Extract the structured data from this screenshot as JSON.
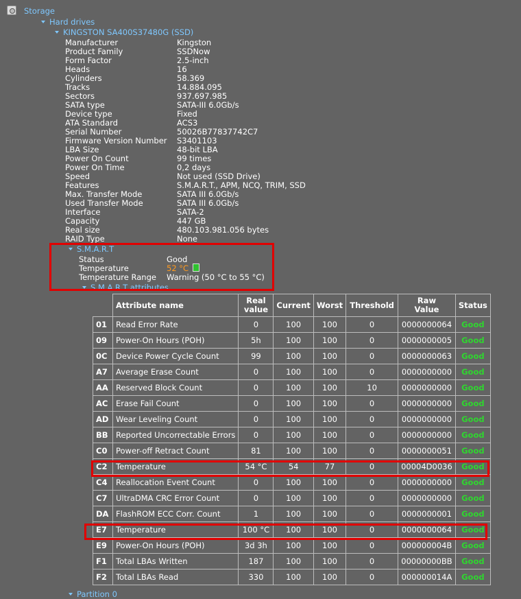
{
  "tree": {
    "root": "Storage",
    "hard_drives": "Hard drives",
    "drive": "KINGSTON SA400S37480G (SSD)",
    "smart": "S.M.A.R.T",
    "smart_attributes": "S.M.A.R.T attributes",
    "partition": "Partition 0"
  },
  "properties": [
    {
      "label": "Manufacturer",
      "value": "Kingston"
    },
    {
      "label": "Product Family",
      "value": "SSDNow"
    },
    {
      "label": "Form Factor",
      "value": "2.5-inch"
    },
    {
      "label": "Heads",
      "value": "16"
    },
    {
      "label": "Cylinders",
      "value": "58.369"
    },
    {
      "label": "Tracks",
      "value": "14.884.095"
    },
    {
      "label": "Sectors",
      "value": "937.697.985"
    },
    {
      "label": "SATA type",
      "value": "SATA-III 6.0Gb/s"
    },
    {
      "label": "Device type",
      "value": "Fixed"
    },
    {
      "label": "ATA Standard",
      "value": "ACS3"
    },
    {
      "label": "Serial Number",
      "value": "50026B77837742C7"
    },
    {
      "label": "Firmware Version Number",
      "value": "S3401103"
    },
    {
      "label": "LBA Size",
      "value": "48-bit LBA"
    },
    {
      "label": "Power On Count",
      "value": "99 times"
    },
    {
      "label": "Power On Time",
      "value": "0,2 days"
    },
    {
      "label": "Speed",
      "value": "Not used (SSD Drive)"
    },
    {
      "label": "Features",
      "value": "S.M.A.R.T., APM, NCQ, TRIM, SSD"
    },
    {
      "label": "Max. Transfer Mode",
      "value": "SATA III 6.0Gb/s"
    },
    {
      "label": "Used Transfer Mode",
      "value": "SATA III 6.0Gb/s"
    },
    {
      "label": "Interface",
      "value": "SATA-2"
    },
    {
      "label": "Capacity",
      "value": "447 GB"
    },
    {
      "label": "Real size",
      "value": "480.103.981.056 bytes"
    },
    {
      "label": "RAID Type",
      "value": "None"
    }
  ],
  "smart": {
    "status_label": "Status",
    "status_value": "Good",
    "temperature_label": "Temperature",
    "temperature_value": "52 °C",
    "temperature_range_label": "Temperature Range",
    "temperature_range_value": "Warning (50 °C to 55 °C)"
  },
  "colors": {
    "background": "#636363",
    "link": "#7fc8ff",
    "good": "#2fd62f",
    "warning": "#ff9a1f",
    "highlight_box": "#e10000"
  },
  "attributes_table": {
    "headers": [
      "Attribute name",
      "Real\nvalue",
      "Current",
      "Worst",
      "Threshold",
      "Raw\nValue",
      "Status"
    ],
    "rows": [
      [
        "01",
        "Read Error Rate",
        "0",
        "100",
        "100",
        "0",
        "0000000064",
        "Good"
      ],
      [
        "09",
        "Power-On Hours (POH)",
        "5h",
        "100",
        "100",
        "0",
        "0000000005",
        "Good"
      ],
      [
        "0C",
        "Device Power Cycle Count",
        "99",
        "100",
        "100",
        "0",
        "0000000063",
        "Good"
      ],
      [
        "A7",
        "Average Erase Count",
        "0",
        "100",
        "100",
        "0",
        "0000000000",
        "Good"
      ],
      [
        "AA",
        "Reserved Block Count",
        "0",
        "100",
        "100",
        "10",
        "0000000000",
        "Good"
      ],
      [
        "AC",
        "Erase Fail Count",
        "0",
        "100",
        "100",
        "0",
        "0000000000",
        "Good"
      ],
      [
        "AD",
        "Wear Leveling Count",
        "0",
        "100",
        "100",
        "0",
        "0000000000",
        "Good"
      ],
      [
        "BB",
        "Reported Uncorrectable Errors",
        "0",
        "100",
        "100",
        "0",
        "0000000000",
        "Good"
      ],
      [
        "C0",
        "Power-off Retract Count",
        "81",
        "100",
        "100",
        "0",
        "0000000051",
        "Good"
      ],
      [
        "C2",
        "Temperature",
        "54 °C",
        "54",
        "77",
        "0",
        "00004D0036",
        "Good"
      ],
      [
        "C4",
        "Reallocation Event Count",
        "0",
        "100",
        "100",
        "0",
        "0000000000",
        "Good"
      ],
      [
        "C7",
        "UltraDMA CRC Error Count",
        "0",
        "100",
        "100",
        "0",
        "0000000000",
        "Good"
      ],
      [
        "DA",
        "FlashROM ECC Corr. Count",
        "1",
        "100",
        "100",
        "0",
        "0000000001",
        "Good"
      ],
      [
        "E7",
        "Temperature",
        "100 °C",
        "100",
        "100",
        "0",
        "0000000064",
        "Good"
      ],
      [
        "E9",
        "Power-On Hours (POH)",
        "3d 3h",
        "100",
        "100",
        "0",
        "000000004B",
        "Good"
      ],
      [
        "F1",
        "Total LBAs Written",
        "187",
        "100",
        "100",
        "0",
        "00000000BB",
        "Good"
      ],
      [
        "F2",
        "Total LBAs Read",
        "330",
        "100",
        "100",
        "0",
        "000000014A",
        "Good"
      ]
    ]
  }
}
